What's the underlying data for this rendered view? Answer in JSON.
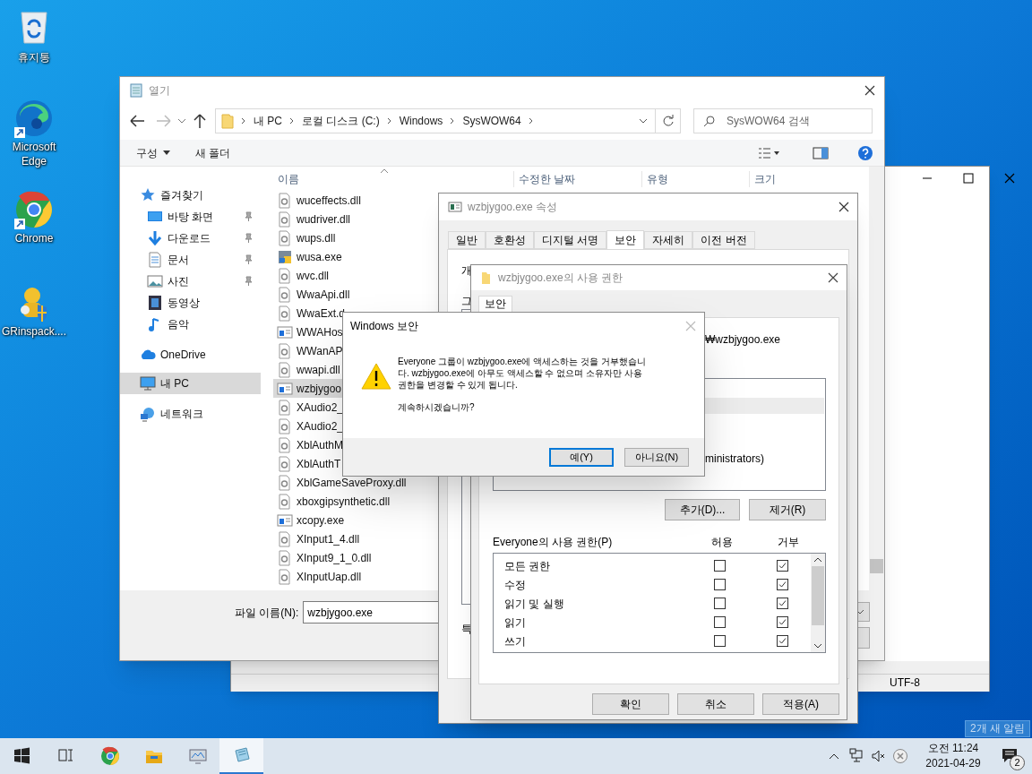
{
  "desktop_icons": [
    {
      "label": "휴지통",
      "kind": "recycle"
    },
    {
      "label": "Microsoft Edge",
      "kind": "edge"
    },
    {
      "label": "Chrome",
      "kind": "chrome"
    },
    {
      "label": "GRinspack....",
      "kind": "setup"
    }
  ],
  "notepad": {
    "encoding": "UTF-8"
  },
  "open_dialog": {
    "title": "열기",
    "breadcrumb": [
      "내 PC",
      "로컬 디스크 (C:)",
      "Windows",
      "SysWOW64"
    ],
    "search_placeholder": "SysWOW64 검색",
    "commands": [
      {
        "label": "구성",
        "dropdown": true
      },
      {
        "label": "새 폴더",
        "dropdown": false
      }
    ],
    "nav": [
      {
        "label": "즐겨찾기",
        "kind": "star",
        "pinned": false,
        "selected": false
      },
      {
        "label": "바탕 화면",
        "kind": "desktop",
        "pinned": true,
        "selected": false
      },
      {
        "label": "다운로드",
        "kind": "download",
        "pinned": true,
        "selected": false
      },
      {
        "label": "문서",
        "kind": "document",
        "pinned": true,
        "selected": false
      },
      {
        "label": "사진",
        "kind": "photo",
        "pinned": true,
        "selected": false
      },
      {
        "label": "동영상",
        "kind": "video",
        "pinned": false,
        "selected": false
      },
      {
        "label": "음악",
        "kind": "music",
        "pinned": false,
        "selected": false
      },
      {
        "label": "OneDrive",
        "kind": "cloud",
        "pinned": false,
        "selected": false
      },
      {
        "label": "내 PC",
        "kind": "pc",
        "pinned": false,
        "selected": true
      },
      {
        "label": "네트워크",
        "kind": "network",
        "pinned": false,
        "selected": false
      }
    ],
    "columns": [
      "이름",
      "수정한 날짜",
      "유형",
      "크기"
    ],
    "files": [
      {
        "name": "wuceffects.dll",
        "kind": "dll",
        "selected": false
      },
      {
        "name": "wudriver.dll",
        "kind": "dll",
        "selected": false
      },
      {
        "name": "wups.dll",
        "kind": "dll",
        "selected": false
      },
      {
        "name": "wusa.exe",
        "kind": "installer",
        "selected": false
      },
      {
        "name": "wvc.dll",
        "kind": "dll",
        "selected": false
      },
      {
        "name": "WwaApi.dll",
        "kind": "dll",
        "selected": false
      },
      {
        "name": "WwaExt.d",
        "kind": "dll",
        "selected": false
      },
      {
        "name": "WWAHos",
        "kind": "exe",
        "selected": false
      },
      {
        "name": "WWanAP",
        "kind": "dll",
        "selected": false
      },
      {
        "name": "wwapi.dll",
        "kind": "dll",
        "selected": false
      },
      {
        "name": "wzbjygoo",
        "kind": "exe",
        "selected": true
      },
      {
        "name": "XAudio2_",
        "kind": "dll",
        "selected": false
      },
      {
        "name": "XAudio2_",
        "kind": "dll",
        "selected": false
      },
      {
        "name": "XblAuthM",
        "kind": "dll",
        "selected": false
      },
      {
        "name": "XblAuthT",
        "kind": "dll",
        "selected": false
      },
      {
        "name": "XblGameSaveProxy.dll",
        "kind": "dll",
        "selected": false
      },
      {
        "name": "xboxgipsynthetic.dll",
        "kind": "dll",
        "selected": false
      },
      {
        "name": "xcopy.exe",
        "kind": "exe",
        "selected": false
      },
      {
        "name": "XInput1_4.dll",
        "kind": "dll",
        "selected": false
      },
      {
        "name": "XInput9_1_0.dll",
        "kind": "dll",
        "selected": false
      },
      {
        "name": "XInputUap.dll",
        "kind": "dll",
        "selected": false
      }
    ],
    "filename_label": "파일 이름(N):",
    "filename": "wzbjygoo.exe"
  },
  "properties": {
    "title": "wzbjygoo.exe 속성",
    "tabs": [
      {
        "label": "일반",
        "selected": false
      },
      {
        "label": "호환성",
        "selected": false
      },
      {
        "label": "디지털 서명",
        "selected": false
      },
      {
        "label": "보안",
        "selected": true
      },
      {
        "label": "자세히",
        "selected": false
      },
      {
        "label": "이전 버전",
        "selected": false
      }
    ],
    "partial_labels": [
      "개",
      "그",
      "특"
    ]
  },
  "permissions": {
    "title": "wzbjygoo.exe의 사용 권한",
    "tab": "보안",
    "object_name": "₩wzbjygoo.exe",
    "group_row": "ministrators)",
    "add_button": "추가(D)...",
    "remove_button": "제거(R)",
    "list_label": "Everyone의 사용 권한(P)",
    "allow_header": "허용",
    "deny_header": "거부",
    "rows": [
      {
        "name": "모든 권한",
        "allow": false,
        "deny": true
      },
      {
        "name": "수정",
        "allow": false,
        "deny": true
      },
      {
        "name": "읽기 및 실행",
        "allow": false,
        "deny": true
      },
      {
        "name": "읽기",
        "allow": false,
        "deny": true
      },
      {
        "name": "쓰기",
        "allow": false,
        "deny": true
      }
    ],
    "buttons": [
      "확인",
      "취소",
      "적용(A)"
    ]
  },
  "alert": {
    "title": "Windows 보안",
    "message_lines": [
      "Everyone 그룹이 wzbjygoo.exe에 액세스하는 것을 거부했습니",
      "다. wzbjygoo.exe에 아무도 액세스할 수 없으며 소유자만 사용",
      "권한을 변경할 수 있게 됩니다."
    ],
    "question": "계속하시겠습니까?",
    "buttons": [
      {
        "label": "예(Y)",
        "selected": true
      },
      {
        "label": "아니요(N)",
        "selected": false
      }
    ]
  },
  "taskbar": {
    "apps": [
      {
        "kind": "start",
        "active": false
      },
      {
        "kind": "taskview",
        "active": false
      },
      {
        "kind": "chrome",
        "active": false
      },
      {
        "kind": "explorer",
        "active": false
      },
      {
        "kind": "monitor",
        "active": false
      },
      {
        "kind": "notepad",
        "active": true
      }
    ],
    "time": "오전 11:24",
    "date": "2021-04-29",
    "notification_count": "2",
    "notification_tooltip": "2개 새 알림"
  }
}
